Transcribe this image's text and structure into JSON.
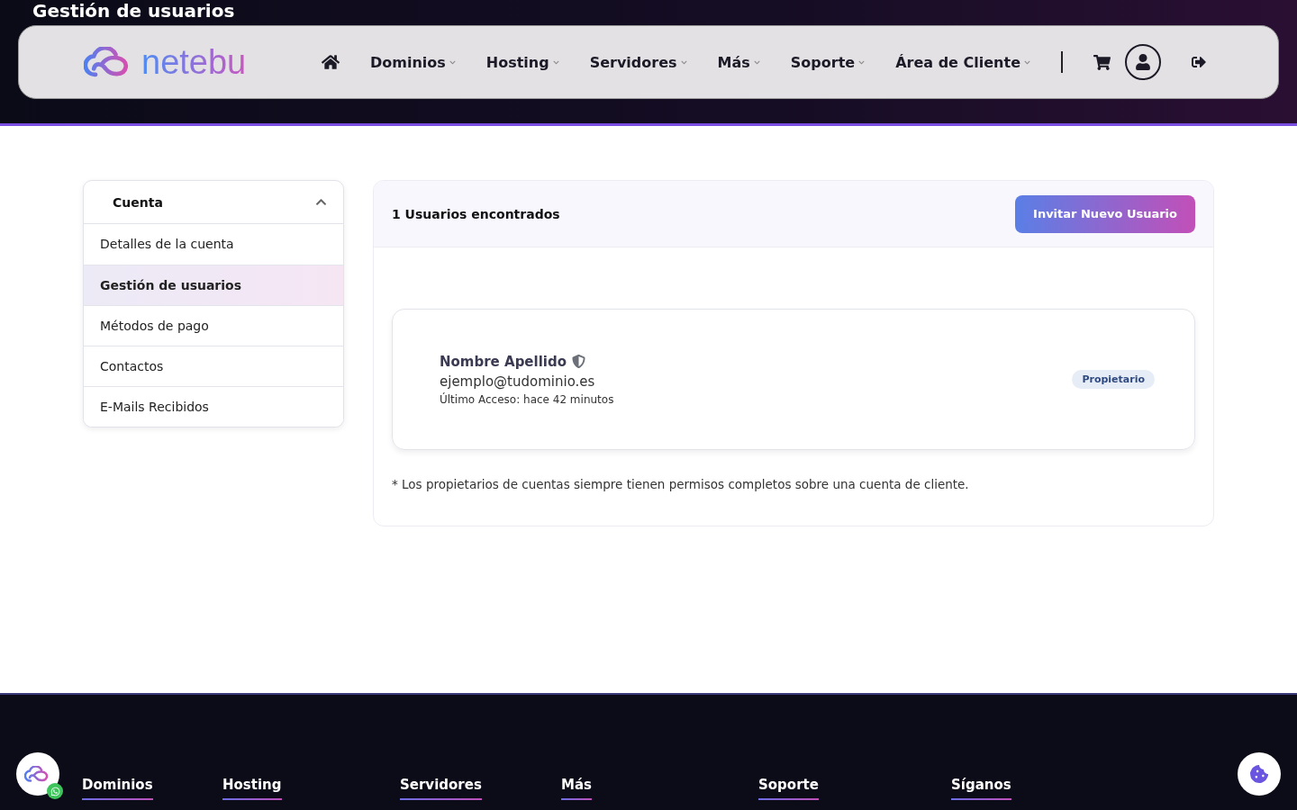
{
  "page_title": "Gestión de usuarios",
  "brand": "netebu",
  "nav": [
    {
      "label": "Dominios"
    },
    {
      "label": "Hosting"
    },
    {
      "label": "Servidores"
    },
    {
      "label": "Más"
    },
    {
      "label": "Soporte"
    },
    {
      "label": "Área de Cliente"
    }
  ],
  "sidebar": {
    "heading": "Cuenta",
    "expanded": true,
    "items": [
      {
        "label": "Detalles de la cuenta",
        "selected": false
      },
      {
        "label": "Gestión de usuarios",
        "selected": true
      },
      {
        "label": "Métodos de pago",
        "selected": false
      },
      {
        "label": "Contactos",
        "selected": false
      },
      {
        "label": "E-Mails Recibidos",
        "selected": false
      }
    ]
  },
  "users_panel": {
    "count_label": "1 Usuarios encontrados",
    "invite_button": "Invitar Nuevo Usuario",
    "users": [
      {
        "name": "Nombre Apellido",
        "email": "ejemplo@tudominio.es",
        "last_access": "Último Acceso: hace 42 minutos",
        "role": "Propietario"
      }
    ],
    "note": "* Los propietarios de cuentas siempre tienen permisos completos sobre una cuenta de cliente."
  },
  "footer": {
    "headings": [
      "Dominios",
      "Hosting",
      "Servidores",
      "Más",
      "Soporte",
      "Síganos"
    ]
  }
}
